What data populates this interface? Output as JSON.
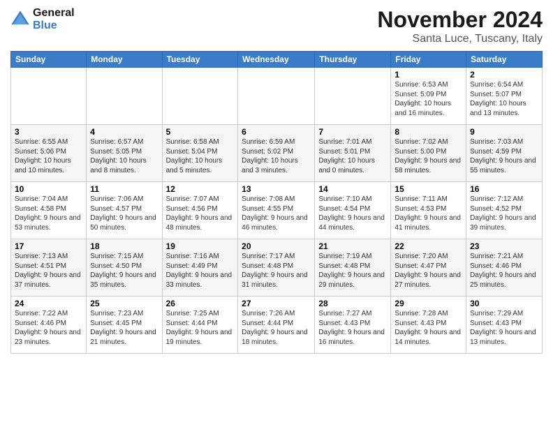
{
  "logo": {
    "line1": "General",
    "line2": "Blue"
  },
  "title": "November 2024",
  "location": "Santa Luce, Tuscany, Italy",
  "weekdays": [
    "Sunday",
    "Monday",
    "Tuesday",
    "Wednesday",
    "Thursday",
    "Friday",
    "Saturday"
  ],
  "weeks": [
    [
      {
        "day": "",
        "info": ""
      },
      {
        "day": "",
        "info": ""
      },
      {
        "day": "",
        "info": ""
      },
      {
        "day": "",
        "info": ""
      },
      {
        "day": "",
        "info": ""
      },
      {
        "day": "1",
        "info": "Sunrise: 6:53 AM\nSunset: 5:09 PM\nDaylight: 10 hours and 16 minutes."
      },
      {
        "day": "2",
        "info": "Sunrise: 6:54 AM\nSunset: 5:07 PM\nDaylight: 10 hours and 13 minutes."
      }
    ],
    [
      {
        "day": "3",
        "info": "Sunrise: 6:55 AM\nSunset: 5:06 PM\nDaylight: 10 hours and 10 minutes."
      },
      {
        "day": "4",
        "info": "Sunrise: 6:57 AM\nSunset: 5:05 PM\nDaylight: 10 hours and 8 minutes."
      },
      {
        "day": "5",
        "info": "Sunrise: 6:58 AM\nSunset: 5:04 PM\nDaylight: 10 hours and 5 minutes."
      },
      {
        "day": "6",
        "info": "Sunrise: 6:59 AM\nSunset: 5:02 PM\nDaylight: 10 hours and 3 minutes."
      },
      {
        "day": "7",
        "info": "Sunrise: 7:01 AM\nSunset: 5:01 PM\nDaylight: 10 hours and 0 minutes."
      },
      {
        "day": "8",
        "info": "Sunrise: 7:02 AM\nSunset: 5:00 PM\nDaylight: 9 hours and 58 minutes."
      },
      {
        "day": "9",
        "info": "Sunrise: 7:03 AM\nSunset: 4:59 PM\nDaylight: 9 hours and 55 minutes."
      }
    ],
    [
      {
        "day": "10",
        "info": "Sunrise: 7:04 AM\nSunset: 4:58 PM\nDaylight: 9 hours and 53 minutes."
      },
      {
        "day": "11",
        "info": "Sunrise: 7:06 AM\nSunset: 4:57 PM\nDaylight: 9 hours and 50 minutes."
      },
      {
        "day": "12",
        "info": "Sunrise: 7:07 AM\nSunset: 4:56 PM\nDaylight: 9 hours and 48 minutes."
      },
      {
        "day": "13",
        "info": "Sunrise: 7:08 AM\nSunset: 4:55 PM\nDaylight: 9 hours and 46 minutes."
      },
      {
        "day": "14",
        "info": "Sunrise: 7:10 AM\nSunset: 4:54 PM\nDaylight: 9 hours and 44 minutes."
      },
      {
        "day": "15",
        "info": "Sunrise: 7:11 AM\nSunset: 4:53 PM\nDaylight: 9 hours and 41 minutes."
      },
      {
        "day": "16",
        "info": "Sunrise: 7:12 AM\nSunset: 4:52 PM\nDaylight: 9 hours and 39 minutes."
      }
    ],
    [
      {
        "day": "17",
        "info": "Sunrise: 7:13 AM\nSunset: 4:51 PM\nDaylight: 9 hours and 37 minutes."
      },
      {
        "day": "18",
        "info": "Sunrise: 7:15 AM\nSunset: 4:50 PM\nDaylight: 9 hours and 35 minutes."
      },
      {
        "day": "19",
        "info": "Sunrise: 7:16 AM\nSunset: 4:49 PM\nDaylight: 9 hours and 33 minutes."
      },
      {
        "day": "20",
        "info": "Sunrise: 7:17 AM\nSunset: 4:48 PM\nDaylight: 9 hours and 31 minutes."
      },
      {
        "day": "21",
        "info": "Sunrise: 7:19 AM\nSunset: 4:48 PM\nDaylight: 9 hours and 29 minutes."
      },
      {
        "day": "22",
        "info": "Sunrise: 7:20 AM\nSunset: 4:47 PM\nDaylight: 9 hours and 27 minutes."
      },
      {
        "day": "23",
        "info": "Sunrise: 7:21 AM\nSunset: 4:46 PM\nDaylight: 9 hours and 25 minutes."
      }
    ],
    [
      {
        "day": "24",
        "info": "Sunrise: 7:22 AM\nSunset: 4:46 PM\nDaylight: 9 hours and 23 minutes."
      },
      {
        "day": "25",
        "info": "Sunrise: 7:23 AM\nSunset: 4:45 PM\nDaylight: 9 hours and 21 minutes."
      },
      {
        "day": "26",
        "info": "Sunrise: 7:25 AM\nSunset: 4:44 PM\nDaylight: 9 hours and 19 minutes."
      },
      {
        "day": "27",
        "info": "Sunrise: 7:26 AM\nSunset: 4:44 PM\nDaylight: 9 hours and 18 minutes."
      },
      {
        "day": "28",
        "info": "Sunrise: 7:27 AM\nSunset: 4:43 PM\nDaylight: 9 hours and 16 minutes."
      },
      {
        "day": "29",
        "info": "Sunrise: 7:28 AM\nSunset: 4:43 PM\nDaylight: 9 hours and 14 minutes."
      },
      {
        "day": "30",
        "info": "Sunrise: 7:29 AM\nSunset: 4:43 PM\nDaylight: 9 hours and 13 minutes."
      }
    ]
  ]
}
